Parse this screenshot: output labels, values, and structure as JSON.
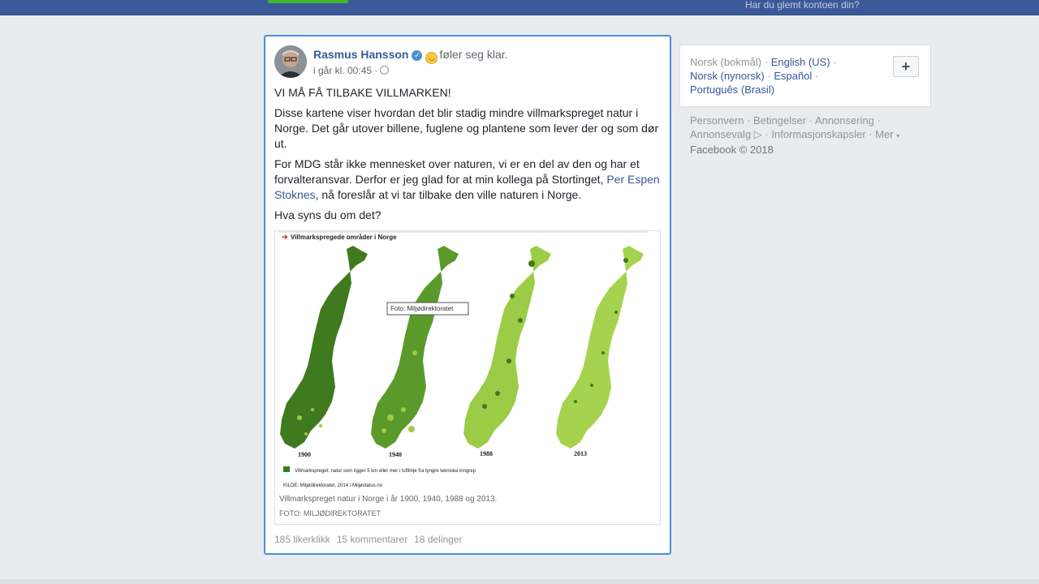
{
  "topbar": {
    "forgot_link": "Har du glemt kontoen din?"
  },
  "post": {
    "author": "Rasmus Hansson",
    "verified_icon": "verified-badge-icon",
    "feeling_emoji": "smiley-emoji-icon",
    "feeling": "føler seg klar.",
    "timestamp": "i går kl. 00:45 ·",
    "privacy_icon": "globe-icon",
    "paragraphs": {
      "p1": "VI MÅ FÅ TILBAKE VILLMARKEN!",
      "p2": "Disse kartene viser hvordan det blir stadig mindre villmarkspreget natur i Norge. Det går utover billene, fuglene og plantene som lever der og som dør ut.",
      "p3_before": "For MDG står ikke mennesket over naturen, vi er en del av den og har et forvalteransvar. Derfor er jeg glad for at min kollega på Stortinget, ",
      "p3_link": "Per Espen Stoknes",
      "p3_after": ", nå foreslår at vi tar tilbake den ville naturen i Norge.",
      "p4": "Hva syns du om det?"
    },
    "image": {
      "title": "Villmarkspregede områder i Norge",
      "photo_credit_box": "Foto: Miljødirektoratet",
      "years": [
        "1900",
        "1940",
        "1988",
        "2013"
      ],
      "legend": "Villmarkspreget: natur som ligger 5 km eller mer i luftlinje fra tyngre tekniske inngrep",
      "source": "KILDE: Miljødirektoratet, 2014 / Miljøstatus.no",
      "caption": "Villmarkspreget natur i Norge i år 1900, 1940, 1988 og 2013.",
      "credit": "FOTO: MILJØDIREKTORATET",
      "colors": {
        "dark": "#3f7a1e",
        "light": "#9ccc46"
      }
    },
    "stats": {
      "likes": "185 likerklikk",
      "comments": "15 kommentarer",
      "shares": "18 delinger"
    }
  },
  "sidebar": {
    "current_language": "Norsk (bokmål) ·",
    "languages": {
      "english": "English (US)",
      "nynorsk": "Norsk (nynorsk)",
      "espanol": "Español",
      "portugues": "Português (Brasil)"
    },
    "add_language_icon": "plus-icon",
    "footer": {
      "personvern": "Personvern",
      "betingelser": "Betingelser",
      "annonsering": "Annonsering",
      "annonsevalg": "Annonsevalg",
      "informasjonskapsler": "Informasjonskapsler",
      "mer": "Mer",
      "copyright": "Facebook © 2018"
    }
  }
}
